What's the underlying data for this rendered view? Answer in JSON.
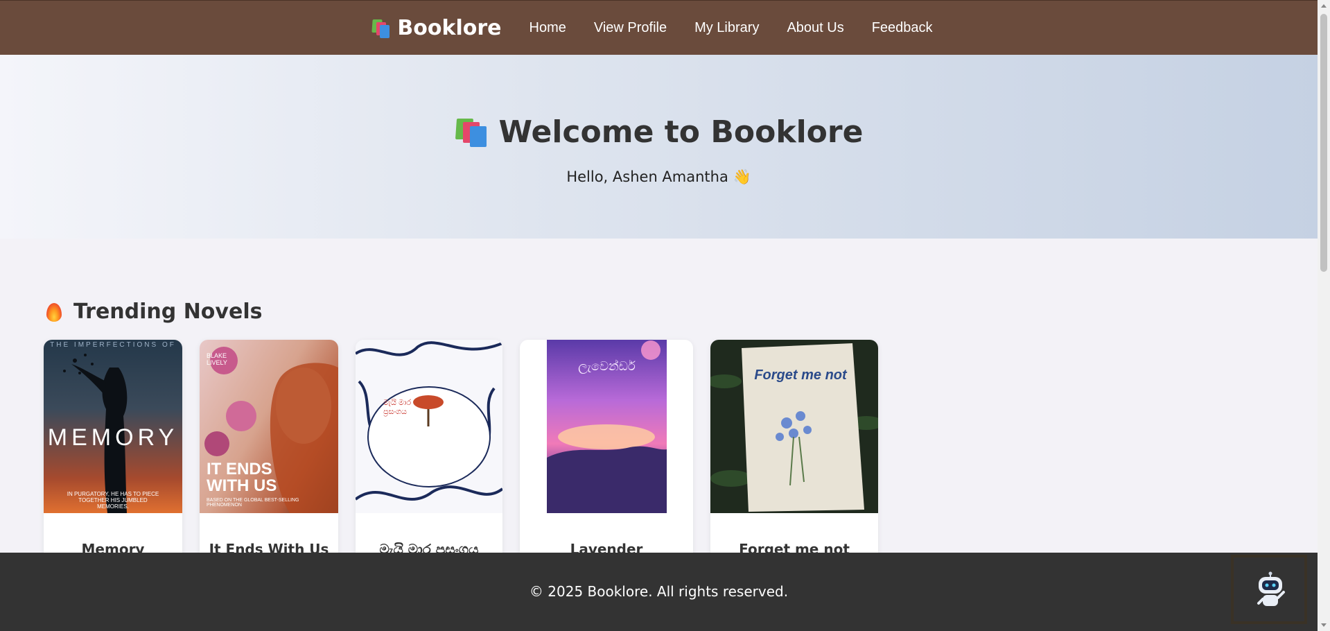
{
  "nav": {
    "brand": "Booklore",
    "links": [
      "Home",
      "View Profile",
      "My Library",
      "About Us",
      "Feedback"
    ]
  },
  "hero": {
    "title": "Welcome to Booklore",
    "greeting": "Hello, Ashen Amantha 👋"
  },
  "trending": {
    "title": "Trending Novels",
    "books": [
      {
        "title": "Memory",
        "cover_top": "THE IMPERFECTIONS OF",
        "cover_title": "MEMORY",
        "cover_tagline": "IN PURGATORY, HE HAS TO PIECE TOGETHER HIS JUMBLED MEMORIES."
      },
      {
        "title": "It Ends With Us",
        "cover_author": "BLAKE LIVELY",
        "cover_title": "IT ENDS WITH US",
        "cover_tagline": "BASED ON THE GLOBAL BEST-SELLING PHENOMENON"
      },
      {
        "title": "මැයි මාර ප්‍රසංගය",
        "cover_title": "මැයි මාර ප්‍රසංගය"
      },
      {
        "title": "Lavender",
        "cover_title": "ලැවෙන්ඩර්"
      },
      {
        "title": "Forget me not",
        "cover_title": "Forget me not"
      }
    ]
  },
  "footer": {
    "text": "© 2025 Booklore. All rights reserved."
  },
  "icons": {
    "brand": "books-stack-icon",
    "section": "fire-icon",
    "chatbot": "robot-icon"
  },
  "colors": {
    "nav_bg": "#6a4b3c",
    "footer_bg": "#333333",
    "page_bg": "#f3f2f7"
  }
}
